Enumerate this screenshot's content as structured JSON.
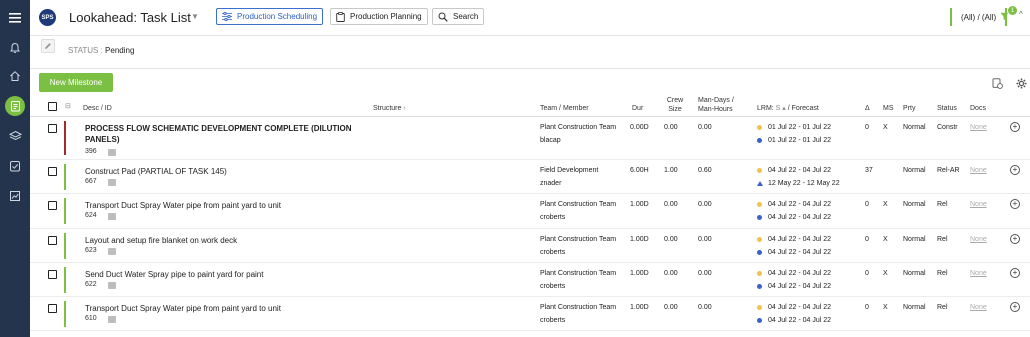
{
  "nav": {
    "items": [
      {
        "name": "menu",
        "active": false
      },
      {
        "name": "bell",
        "active": false
      },
      {
        "name": "home",
        "active": false
      },
      {
        "name": "tasks",
        "active": true
      },
      {
        "name": "layers",
        "active": false
      },
      {
        "name": "checklist",
        "active": false
      },
      {
        "name": "reports",
        "active": false
      }
    ],
    "accent": "#7bc043",
    "background": "#24344d"
  },
  "header": {
    "logo_text": "SPS",
    "title": "Lookahead: Task List",
    "buttons": {
      "production_scheduling": "Production Scheduling",
      "production_planning": "Production Planning",
      "search": "Search"
    },
    "filter_label": "(All) / (All)",
    "filter_badge": "1"
  },
  "status_bar": {
    "label": "STATUS : ",
    "value": "Pending"
  },
  "toolbar": {
    "new_milestone": "New Milestone"
  },
  "table": {
    "columns": {
      "desc": "Desc / ID",
      "structure": "Structure",
      "team": "Team / Member",
      "dur": "Dur",
      "crew_l1": "Crew",
      "crew_l2": "Size",
      "mandays_l1": "Man-Days /",
      "mandays_l2": "Man-Hours",
      "lrm_prefix": "LRM: ",
      "lrm_s": "S",
      "lrm_suffix": " / Forecast",
      "delta": "Δ",
      "ms": "MS",
      "prty": "Prty",
      "status": "Status",
      "docs": "Docs"
    },
    "rows": [
      {
        "title": "PROCESS FLOW SCHEMATIC DEVELOPMENT COMPLETE (DILUTION PANELS)",
        "bold": true,
        "id": "396",
        "bar_color": "#a32a2a",
        "team": "Plant Construction Team",
        "member": "blacap",
        "dur": "0.00D",
        "crew": "0.00",
        "mandays": "0.00",
        "lrm1": "01 Jul 22 - 01 Jul 22",
        "lrm2": "01 Jul 22 - 01 Jul 22",
        "lrm2_marker": "dot",
        "delta": "0",
        "ms": "X",
        "prty": "Normal",
        "status": "Constr",
        "docs": "None"
      },
      {
        "title": "Construct Pad (PARTIAL OF TASK 145)",
        "bold": false,
        "id": "667",
        "bar_color": "#7bc043",
        "team": "Field Development",
        "member": "znader",
        "dur": "6.00H",
        "crew": "1.00",
        "mandays": "0.60",
        "lrm1": "04 Jul 22 - 04 Jul 22",
        "lrm2": "12 May 22 - 12 May 22",
        "lrm2_marker": "triangle",
        "delta": "37",
        "ms": "",
        "prty": "Normal",
        "status": "Rel-AR",
        "docs": "None"
      },
      {
        "title": "Transport Duct Spray Water pipe from paint yard to unit",
        "bold": false,
        "id": "624",
        "bar_color": "#7bc043",
        "team": "Plant Construction Team",
        "member": "croberts",
        "dur": "1.00D",
        "crew": "0.00",
        "mandays": "0.00",
        "lrm1": "04 Jul 22 - 04 Jul 22",
        "lrm2": "04 Jul 22 - 04 Jul 22",
        "lrm2_marker": "dot",
        "delta": "0",
        "ms": "X",
        "prty": "Normal",
        "status": "Rel",
        "docs": "None"
      },
      {
        "title": "Layout and setup fire blanket on work deck",
        "bold": false,
        "id": "623",
        "bar_color": "#7bc043",
        "team": "Plant Construction Team",
        "member": "croberts",
        "dur": "1.00D",
        "crew": "0.00",
        "mandays": "0.00",
        "lrm1": "04 Jul 22 - 04 Jul 22",
        "lrm2": "04 Jul 22 - 04 Jul 22",
        "lrm2_marker": "dot",
        "delta": "0",
        "ms": "X",
        "prty": "Normal",
        "status": "Rel",
        "docs": "None"
      },
      {
        "title": "Send Duct Water Spray pipe to paint yard for paint",
        "bold": false,
        "id": "622",
        "bar_color": "#7bc043",
        "team": "Plant Construction Team",
        "member": "croberts",
        "dur": "1.00D",
        "crew": "0.00",
        "mandays": "0.00",
        "lrm1": "04 Jul 22 - 04 Jul 22",
        "lrm2": "04 Jul 22 - 04 Jul 22",
        "lrm2_marker": "dot",
        "delta": "0",
        "ms": "X",
        "prty": "Normal",
        "status": "Rel",
        "docs": "None"
      },
      {
        "title": "Transport Duct Spray Water pipe from paint yard to unit",
        "bold": false,
        "id": "610",
        "bar_color": "#7bc043",
        "team": "Plant Construction Team",
        "member": "croberts",
        "dur": "1.00D",
        "crew": "0.00",
        "mandays": "0.00",
        "lrm1": "04 Jul 22 - 04 Jul 22",
        "lrm2": "04 Jul 22 - 04 Jul 22",
        "lrm2_marker": "dot",
        "delta": "0",
        "ms": "X",
        "prty": "Normal",
        "status": "Rel",
        "docs": "None"
      }
    ]
  }
}
